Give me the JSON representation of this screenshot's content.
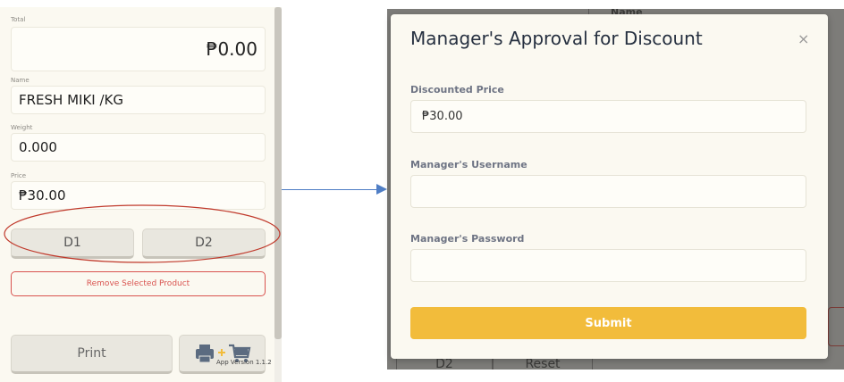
{
  "pos": {
    "total": {
      "label": "Total",
      "value": "₱0.00"
    },
    "name": {
      "label": "Name",
      "value": "FRESH MIKI /KG"
    },
    "weight": {
      "label": "Weight",
      "value": "0.000"
    },
    "price": {
      "label": "Price",
      "value": "₱30.00"
    },
    "discount_buttons": [
      "D1",
      "D2"
    ],
    "remove_label": "Remove Selected Product",
    "print_label": "Print",
    "print_cart_icons": [
      "printer-icon",
      "plus-icon",
      "cart-icon"
    ],
    "app_version": "App Version 1.1.2"
  },
  "background_page": {
    "header_text": "Name",
    "buttons": [
      "D2",
      "Reset"
    ]
  },
  "modal": {
    "title": "Manager's Approval for Discount",
    "close_icon": "×",
    "fields": [
      {
        "label": "Discounted Price",
        "value": "₱30.00"
      },
      {
        "label": "Manager's Username",
        "value": ""
      },
      {
        "label": "Manager's Password",
        "value": ""
      }
    ],
    "submit_label": "Submit"
  },
  "colors": {
    "accent_submit": "#f2bc3b",
    "annotation_ellipse": "#c0392b",
    "annotation_arrow": "#4f7ec5",
    "danger": "#d9534f"
  }
}
